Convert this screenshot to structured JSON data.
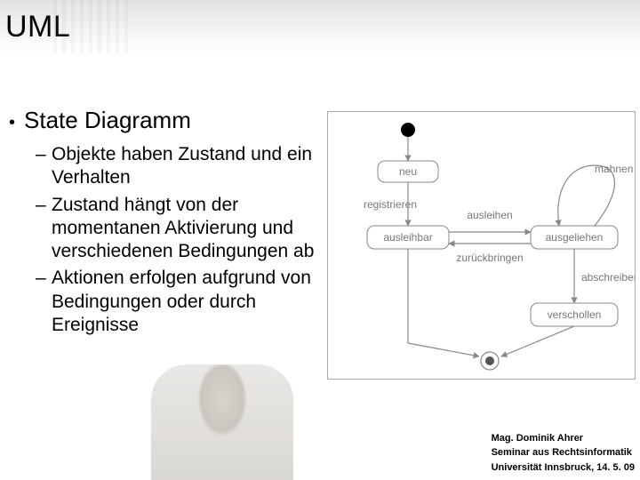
{
  "title": "UML",
  "heading": "State Diagramm",
  "bullets": [
    "Objekte haben Zustand und ein Verhalten",
    "Zustand hängt von der momentanen Aktivierung und verschiedenen Bedingungen ab",
    "Aktionen erfolgen aufgrund von Bedingungen oder durch Ereignisse"
  ],
  "chart_data": {
    "type": "state_diagram",
    "initial_state": true,
    "final_state": true,
    "states": [
      "neu",
      "ausleihbar",
      "ausgeliehen",
      "verschollen"
    ],
    "transitions": [
      {
        "from": "initial",
        "to": "neu",
        "label": ""
      },
      {
        "from": "neu",
        "to": "ausleihbar",
        "label": "registrieren"
      },
      {
        "from": "ausleihbar",
        "to": "ausgeliehen",
        "label": "ausleihen"
      },
      {
        "from": "ausgeliehen",
        "to": "ausleihbar",
        "label": "zurückbringen"
      },
      {
        "from": "ausgeliehen",
        "to": "ausgeliehen",
        "label": "mahnen"
      },
      {
        "from": "ausgeliehen",
        "to": "verschollen",
        "label": "abschreiben"
      },
      {
        "from": "verschollen",
        "to": "final",
        "label": ""
      },
      {
        "from": "ausleihbar",
        "to": "final",
        "label": ""
      }
    ]
  },
  "footer": {
    "author": "Mag. Dominik Ahrer",
    "seminar": "Seminar aus Rechtsinformatik",
    "affiliation": "Universität Innsbruck, 14. 5. 09"
  }
}
